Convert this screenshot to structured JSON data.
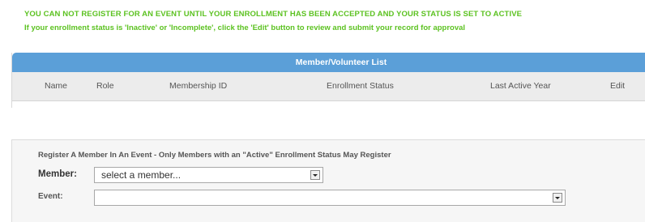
{
  "notices": {
    "line1": "YOU CAN NOT REGISTER FOR AN EVENT UNTIL YOUR ENROLLMENT HAS BEEN ACCEPTED AND YOUR STATUS IS SET TO ACTIVE",
    "line2": "If your enrollment status is 'Inactive' or 'Incomplete', click the 'Edit' button to review and submit your record for approval",
    "color": "#5cc221"
  },
  "member_list": {
    "title": "Member/Volunteer List",
    "header_color": "#5b9fd8",
    "columns": [
      "Name",
      "Role",
      "Membership ID",
      "Enrollment Status",
      "Last Active Year",
      "Edit"
    ],
    "rows": []
  },
  "register": {
    "title": "Register A Member In An Event - Only Members with an \"Active\" Enrollment Status May Register",
    "member_label": "Member:",
    "member_value": "select a member...",
    "event_label": "Event:",
    "event_value": ""
  }
}
